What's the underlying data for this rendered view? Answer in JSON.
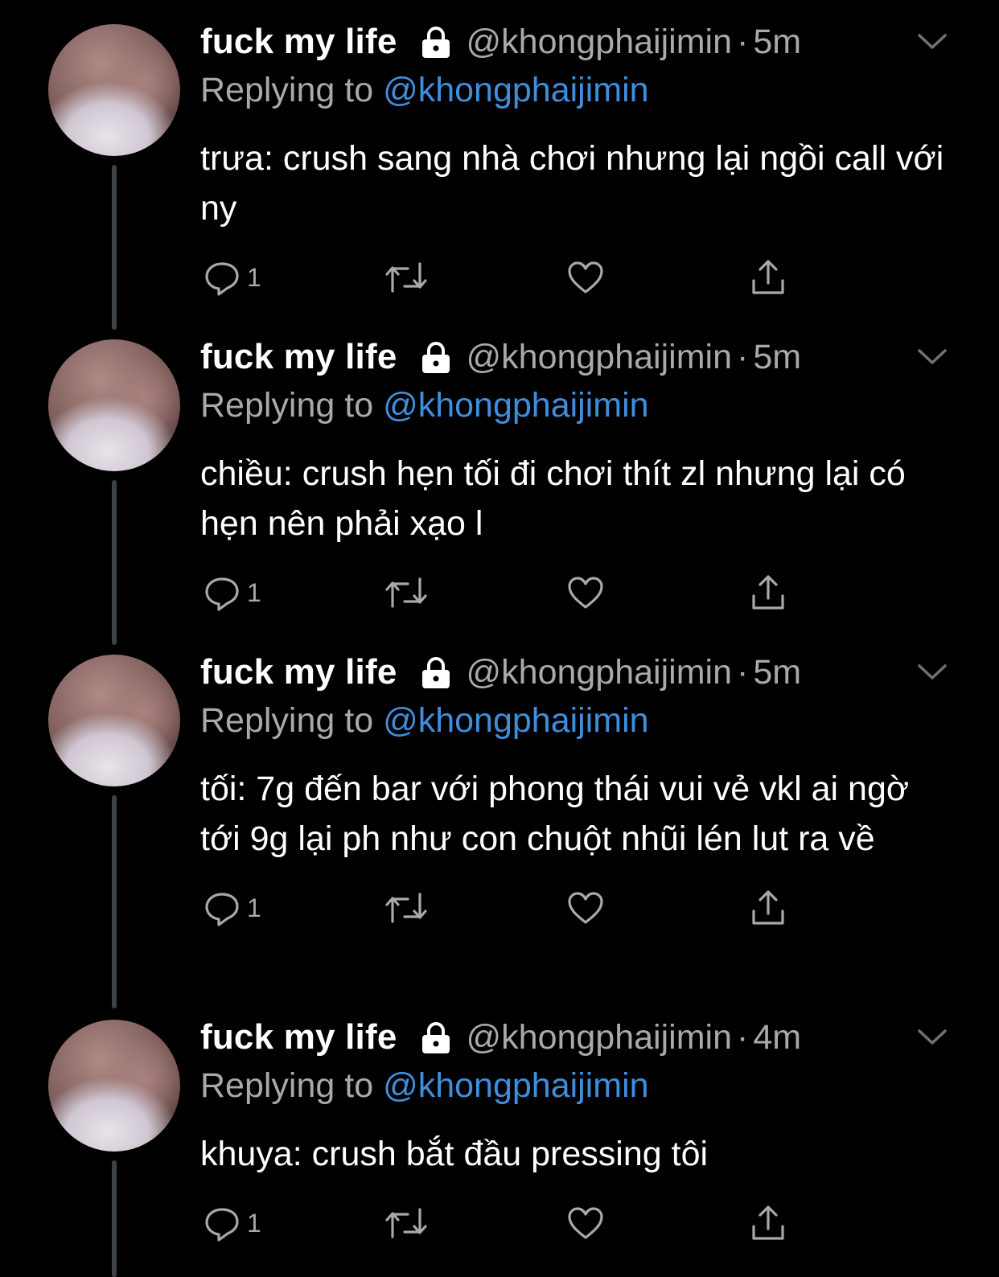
{
  "colors": {
    "background": "#000000",
    "text": "#ffffff",
    "secondary": "#a7a9ab",
    "mention": "#3f8edc",
    "thread_line": "#3d4247"
  },
  "tweets": [
    {
      "name": "fuck my life",
      "handle": "@khongphaijimin",
      "separator": "·",
      "time": "5m",
      "replying_prefix": "Replying to ",
      "replying_to": "@khongphaijimin",
      "text": "trưa: crush sang nhà chơi nhưng lại ngồi call với ny",
      "reply_count": "1"
    },
    {
      "name": "fuck my life",
      "handle": "@khongphaijimin",
      "separator": "·",
      "time": "5m",
      "replying_prefix": "Replying to ",
      "replying_to": "@khongphaijimin",
      "text": "chiều: crush hẹn tối đi chơi thít zl nhưng lại có hẹn nên phải xạo l",
      "reply_count": "1"
    },
    {
      "name": "fuck my life",
      "handle": "@khongphaijimin",
      "separator": "·",
      "time": "5m",
      "replying_prefix": "Replying to ",
      "replying_to": "@khongphaijimin",
      "text": "tối: 7g đến bar với phong thái vui vẻ vkl ai ngờ tới 9g lại ph như con chuột nhũi lén lut ra về",
      "reply_count": "1"
    },
    {
      "name": "fuck my life",
      "handle": "@khongphaijimin",
      "separator": "·",
      "time": "4m",
      "replying_prefix": "Replying to ",
      "replying_to": "@khongphaijimin",
      "text": "khuya: crush bắt đầu pressing tôi",
      "reply_count": "1"
    }
  ],
  "icons": [
    "lock-icon",
    "chevron-down-icon",
    "reply-icon",
    "retweet-icon",
    "like-icon",
    "share-icon"
  ]
}
